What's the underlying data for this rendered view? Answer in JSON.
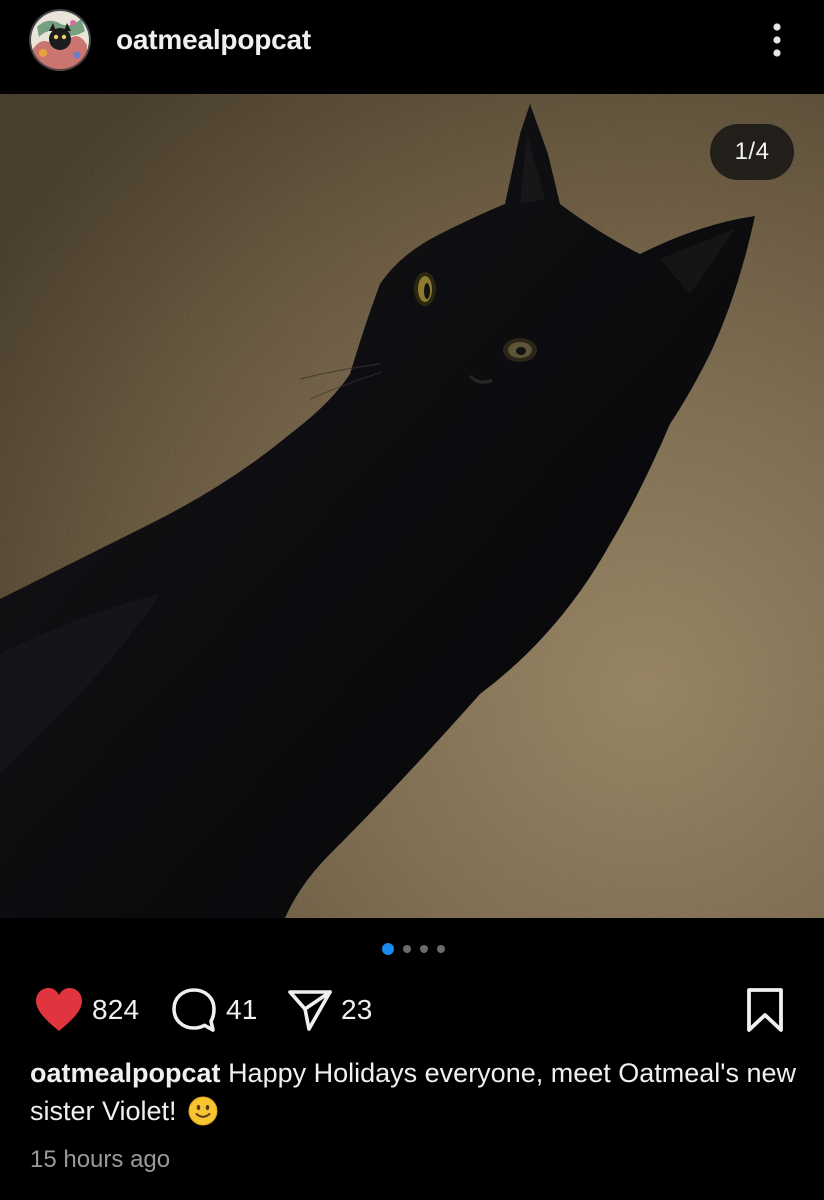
{
  "post": {
    "username": "oatmealpopcat",
    "more_icon": "more-vertical-icon",
    "media_counter": "1/4",
    "carousel": {
      "total": 4,
      "active_index": 0
    },
    "actions": {
      "likes": "824",
      "comments": "41",
      "shares": "23",
      "like_icon": "heart-icon",
      "comment_icon": "comment-bubble-icon",
      "share_icon": "send-icon",
      "save_icon": "bookmark-icon"
    },
    "caption": {
      "username": "oatmealpopcat",
      "text": "Happy Holidays everyone, meet Oatmeal's new sister Violet!",
      "emoji": "slightly-smiling-face"
    },
    "timestamp": "15 hours ago"
  },
  "colors": {
    "background": "#000000",
    "like_red": "#e0353f",
    "active_dot": "#1a8bf0",
    "inactive_dot": "#6b6b6b",
    "muted_text": "#9a9a9a"
  }
}
